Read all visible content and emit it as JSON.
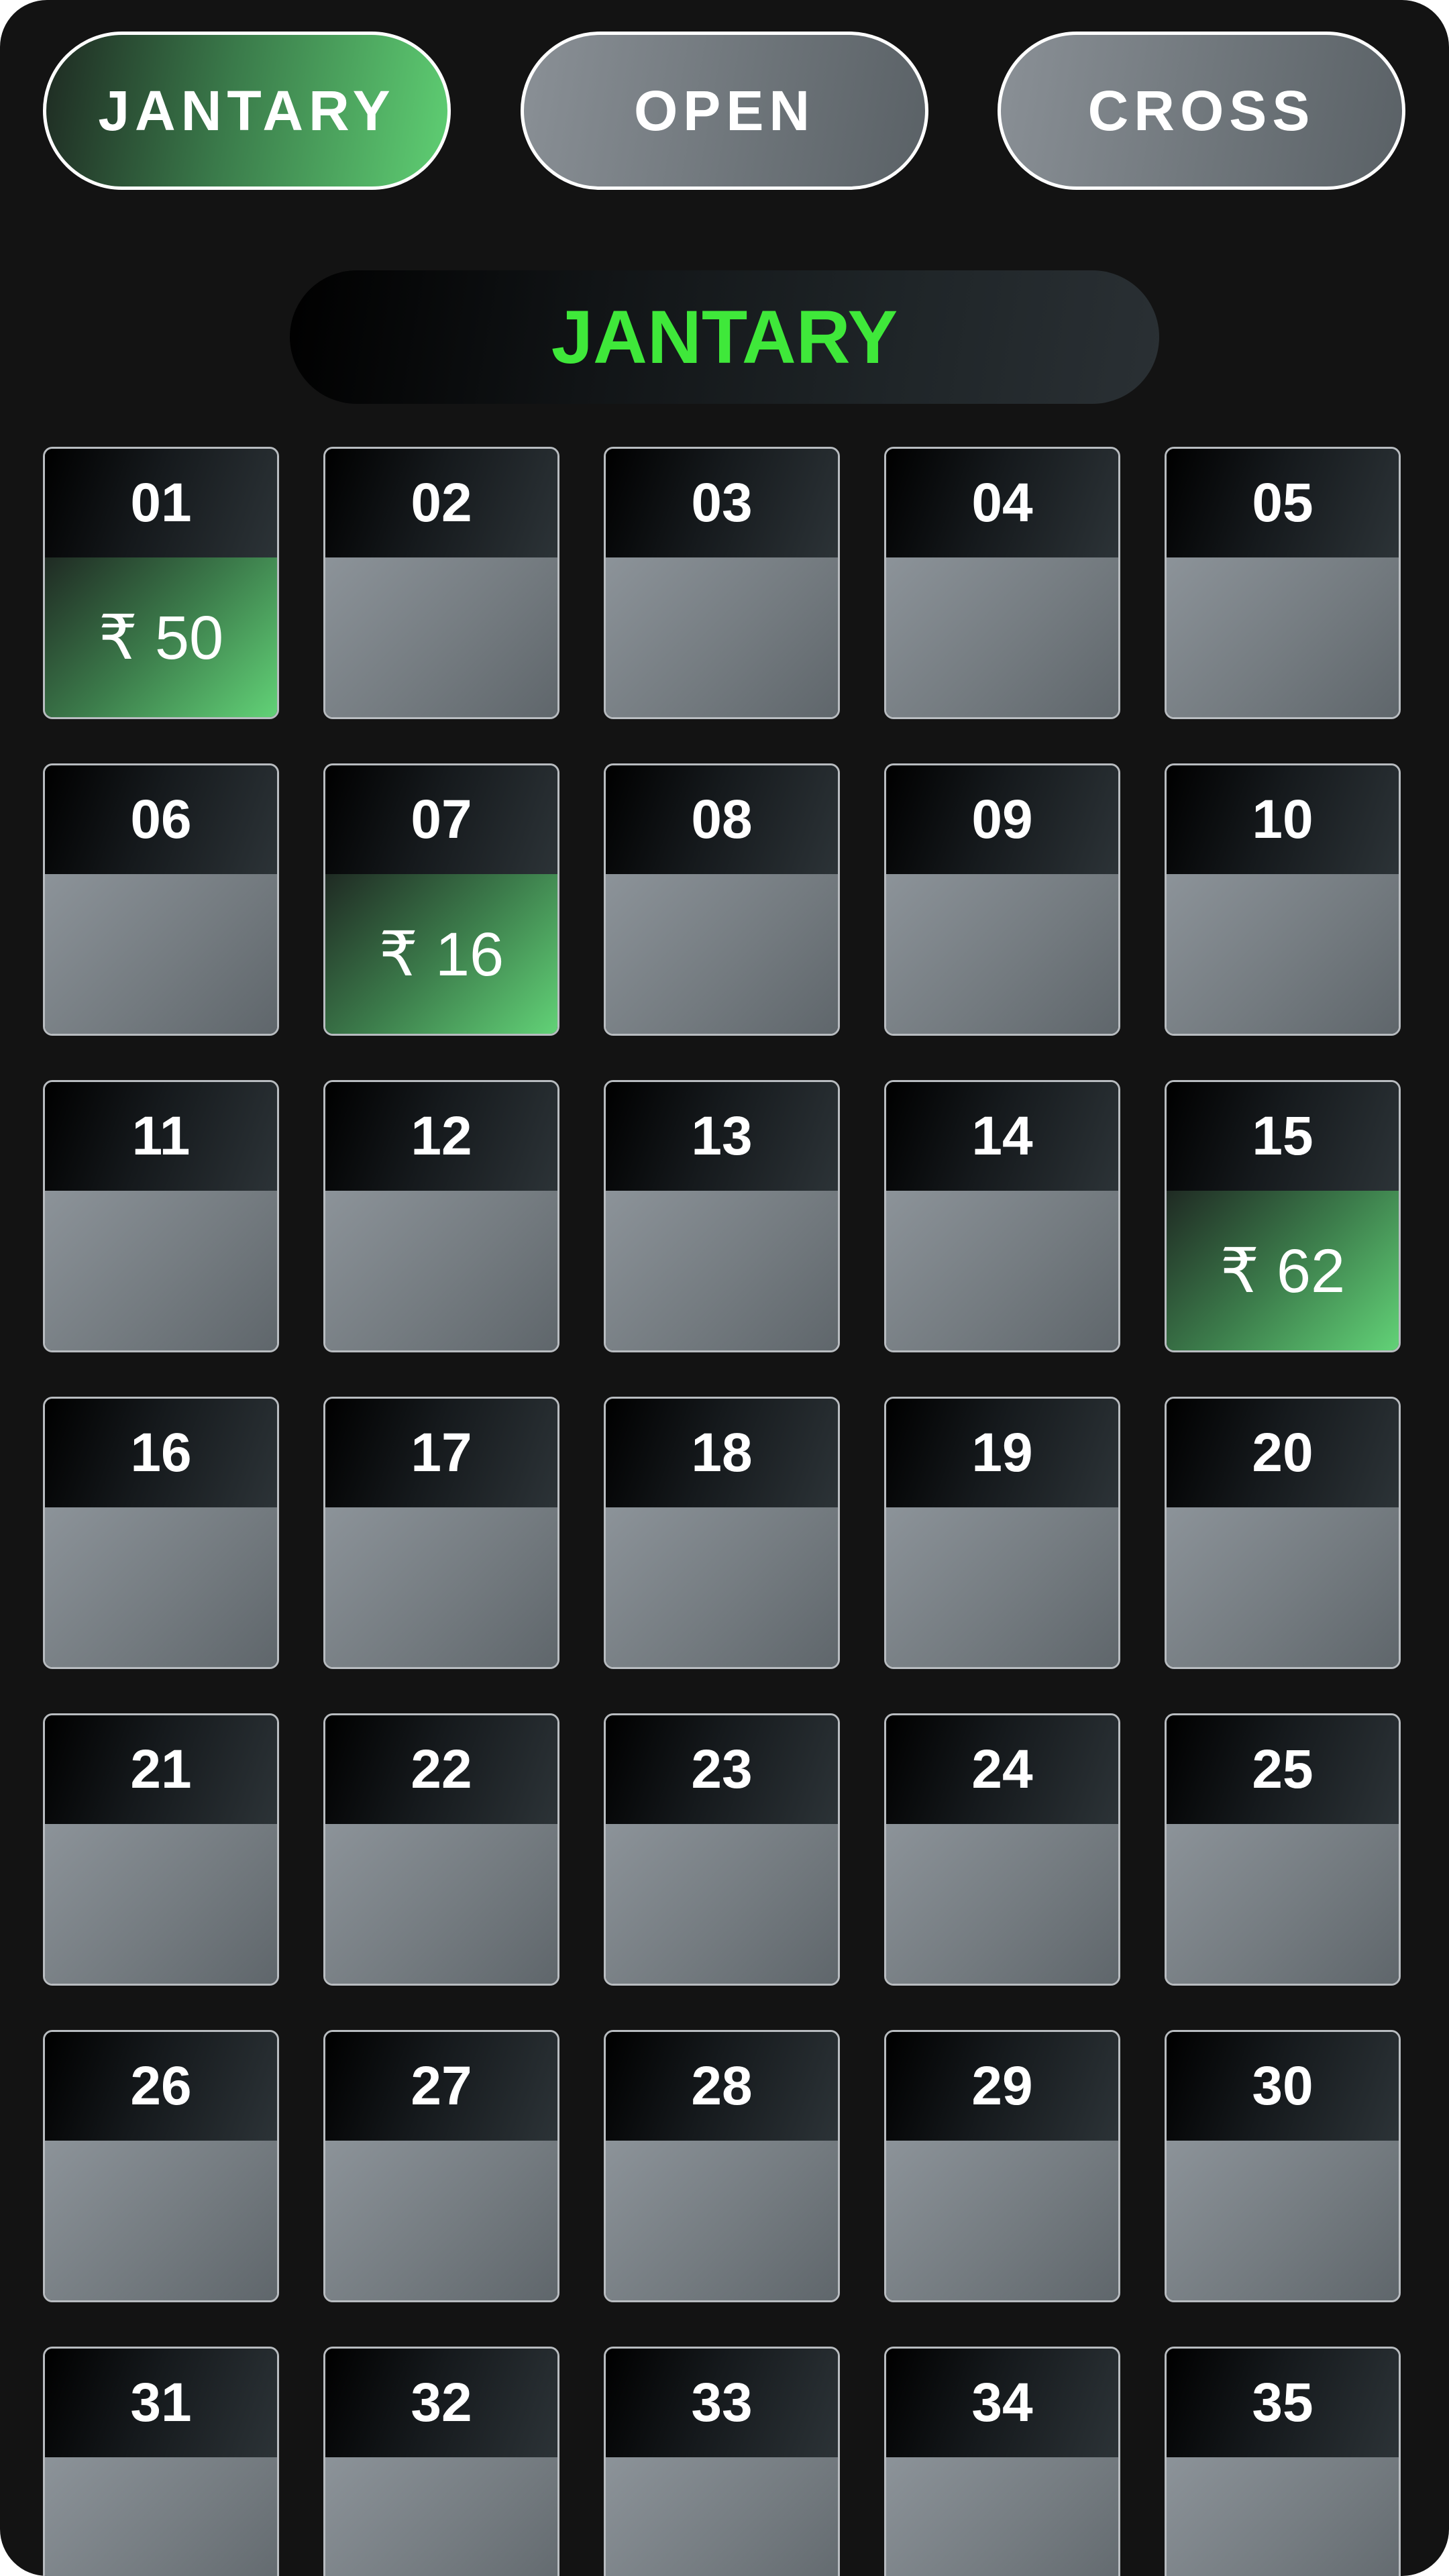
{
  "tabs": [
    {
      "label": "JANTARY",
      "active": true
    },
    {
      "label": "OPEN",
      "active": false
    },
    {
      "label": "CROSS",
      "active": false
    }
  ],
  "section_title": "JANTARY",
  "colors": {
    "accent_green": "#3fe83a",
    "win_green": "#62d277",
    "background": "#131313",
    "cell_grey": "#747b80"
  },
  "cells": [
    {
      "number": "01",
      "amount": "₹ 50"
    },
    {
      "number": "02",
      "amount": ""
    },
    {
      "number": "03",
      "amount": ""
    },
    {
      "number": "04",
      "amount": ""
    },
    {
      "number": "05",
      "amount": ""
    },
    {
      "number": "06",
      "amount": ""
    },
    {
      "number": "07",
      "amount": "₹ 16"
    },
    {
      "number": "08",
      "amount": ""
    },
    {
      "number": "09",
      "amount": ""
    },
    {
      "number": "10",
      "amount": ""
    },
    {
      "number": "11",
      "amount": ""
    },
    {
      "number": "12",
      "amount": ""
    },
    {
      "number": "13",
      "amount": ""
    },
    {
      "number": "14",
      "amount": ""
    },
    {
      "number": "15",
      "amount": "₹ 62"
    },
    {
      "number": "16",
      "amount": ""
    },
    {
      "number": "17",
      "amount": ""
    },
    {
      "number": "18",
      "amount": ""
    },
    {
      "number": "19",
      "amount": ""
    },
    {
      "number": "20",
      "amount": ""
    },
    {
      "number": "21",
      "amount": ""
    },
    {
      "number": "22",
      "amount": ""
    },
    {
      "number": "23",
      "amount": ""
    },
    {
      "number": "24",
      "amount": ""
    },
    {
      "number": "25",
      "amount": ""
    },
    {
      "number": "26",
      "amount": ""
    },
    {
      "number": "27",
      "amount": ""
    },
    {
      "number": "28",
      "amount": ""
    },
    {
      "number": "29",
      "amount": ""
    },
    {
      "number": "30",
      "amount": ""
    },
    {
      "number": "31",
      "amount": ""
    },
    {
      "number": "32",
      "amount": ""
    },
    {
      "number": "33",
      "amount": ""
    },
    {
      "number": "34",
      "amount": ""
    },
    {
      "number": "35",
      "amount": ""
    }
  ]
}
